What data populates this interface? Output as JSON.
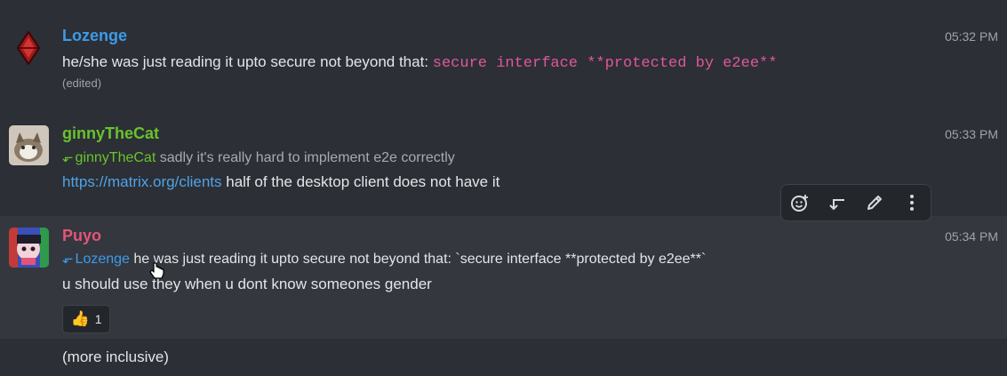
{
  "messages": [
    {
      "sender": "Lozenge",
      "time": "05:32 PM",
      "text_prefix": "he/she was just reading it upto secure not beyond that:",
      "text_code": "secure interface **protected by e2ee**",
      "edited": "(edited)"
    },
    {
      "sender": "ginnyTheCat",
      "time": "05:33 PM",
      "reply_to": "ginnyTheCat",
      "reply_text": "sadly it's really hard to implement e2e correctly",
      "link": "https://matrix.org/clients",
      "text": "half of the desktop client does not have it"
    },
    {
      "sender": "Puyo",
      "time": "05:34 PM",
      "reply_to": "Lozenge",
      "reply_text": "he was just reading it upto secure not beyond that: `secure interface **protected by e2ee**`",
      "text": "u should use they when u dont know someones gender",
      "reaction": {
        "emoji": "👍",
        "count": "1"
      }
    },
    {
      "text": "(more inclusive)"
    }
  ],
  "toolbar": {
    "icons": [
      "add-reaction-icon",
      "reply-icon",
      "edit-icon",
      "more-options-icon"
    ]
  },
  "colors": {
    "lozenge": "#3d9be9",
    "ginny": "#69c32d",
    "puyo": "#e2557a",
    "background": "#2c2f35",
    "hover": "#34373e"
  }
}
